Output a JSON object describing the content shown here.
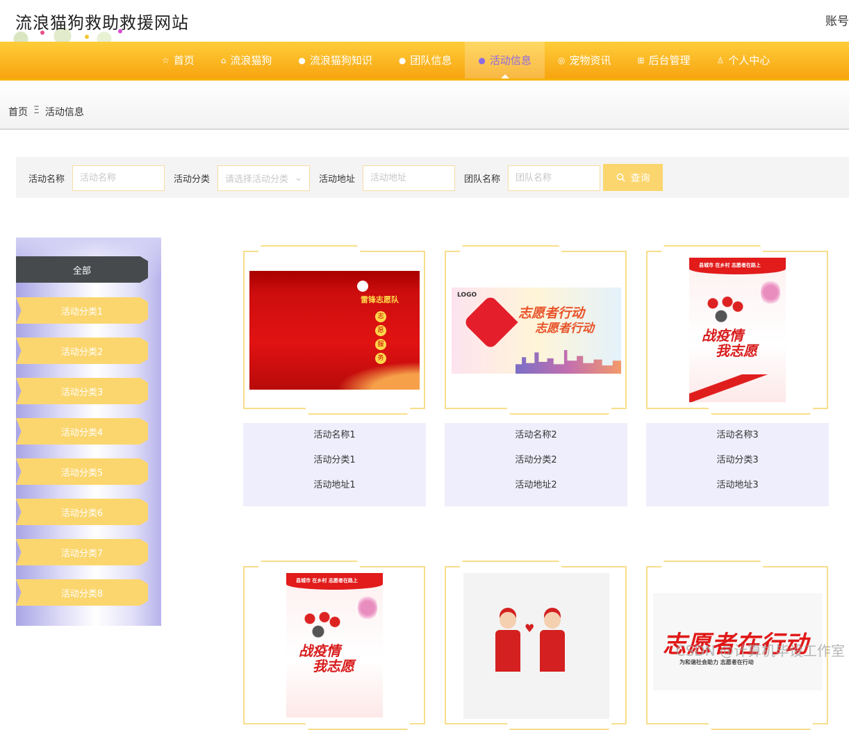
{
  "header": {
    "site_title": "流浪猫狗救助救援网站",
    "account_label": "账号"
  },
  "nav": {
    "items": [
      {
        "icon": "star-icon",
        "glyph": "☆",
        "label": "首页"
      },
      {
        "icon": "bag-icon",
        "glyph": "⌂",
        "label": "流浪猫狗"
      },
      {
        "icon": "info-icon",
        "glyph": "●",
        "label": "流浪猫狗知识"
      },
      {
        "icon": "question-icon",
        "glyph": "●",
        "label": "团队信息"
      },
      {
        "icon": "info-circle-icon",
        "glyph": "●",
        "label": "活动信息"
      },
      {
        "icon": "settings-icon",
        "glyph": "◎",
        "label": "宠物资讯"
      },
      {
        "icon": "gift-icon",
        "glyph": "⊞",
        "label": "后台管理"
      },
      {
        "icon": "user-icon",
        "glyph": "♙",
        "label": "个人中心"
      }
    ],
    "active_index": 4,
    "active_color": "#8e6be0"
  },
  "breadcrumb": {
    "home": "首页",
    "separator": "Ξ",
    "current": "活动信息"
  },
  "search": {
    "name_label": "活动名称",
    "name_placeholder": "活动名称",
    "category_label": "活动分类",
    "category_placeholder": "请选择活动分类",
    "address_label": "活动地址",
    "address_placeholder": "活动地址",
    "team_label": "团队名称",
    "team_placeholder": "团队名称",
    "button_label": "查询"
  },
  "categories": {
    "items": [
      "全部",
      "活动分类1",
      "活动分类2",
      "活动分类3",
      "活动分类4",
      "活动分类5",
      "活动分类6",
      "活动分类7",
      "活动分类8"
    ],
    "active_index": 0
  },
  "cards": [
    {
      "name": "活动名称1",
      "category": "活动分类1",
      "address": "活动地址1",
      "poster": {
        "title": "雷锋志愿队",
        "slogan": [
          "志",
          "愿",
          "服",
          "务"
        ]
      }
    },
    {
      "name": "活动名称2",
      "category": "活动分类2",
      "address": "活动地址2",
      "poster": {
        "logo": "LOGO",
        "title": "志愿者行动",
        "title2": "志愿者行动"
      }
    },
    {
      "name": "活动名称3",
      "category": "活动分类3",
      "address": "活动地址3",
      "poster": {
        "top": "县城市 在乡村 志愿者在路上",
        "title": "战疫情",
        "title2": "我志愿"
      }
    },
    {
      "poster": {
        "top": "县城市 在乡村 志愿者在路上",
        "title": "战疫情",
        "title2": "我志愿"
      }
    },
    {
      "poster": {}
    },
    {
      "poster": {
        "title": "志愿者在行动",
        "sub": "为和谐社会助力 志愿者在行动"
      }
    }
  ],
  "watermark": "CSDN @计算机毕设工作室",
  "colors": {
    "nav_gradient_top": "#ffcd3a",
    "nav_gradient_bottom": "#f7a40f",
    "accent_yellow": "#fbd66e",
    "card_border": "#f8dd8b",
    "card_info_bg": "#eeeefc"
  }
}
